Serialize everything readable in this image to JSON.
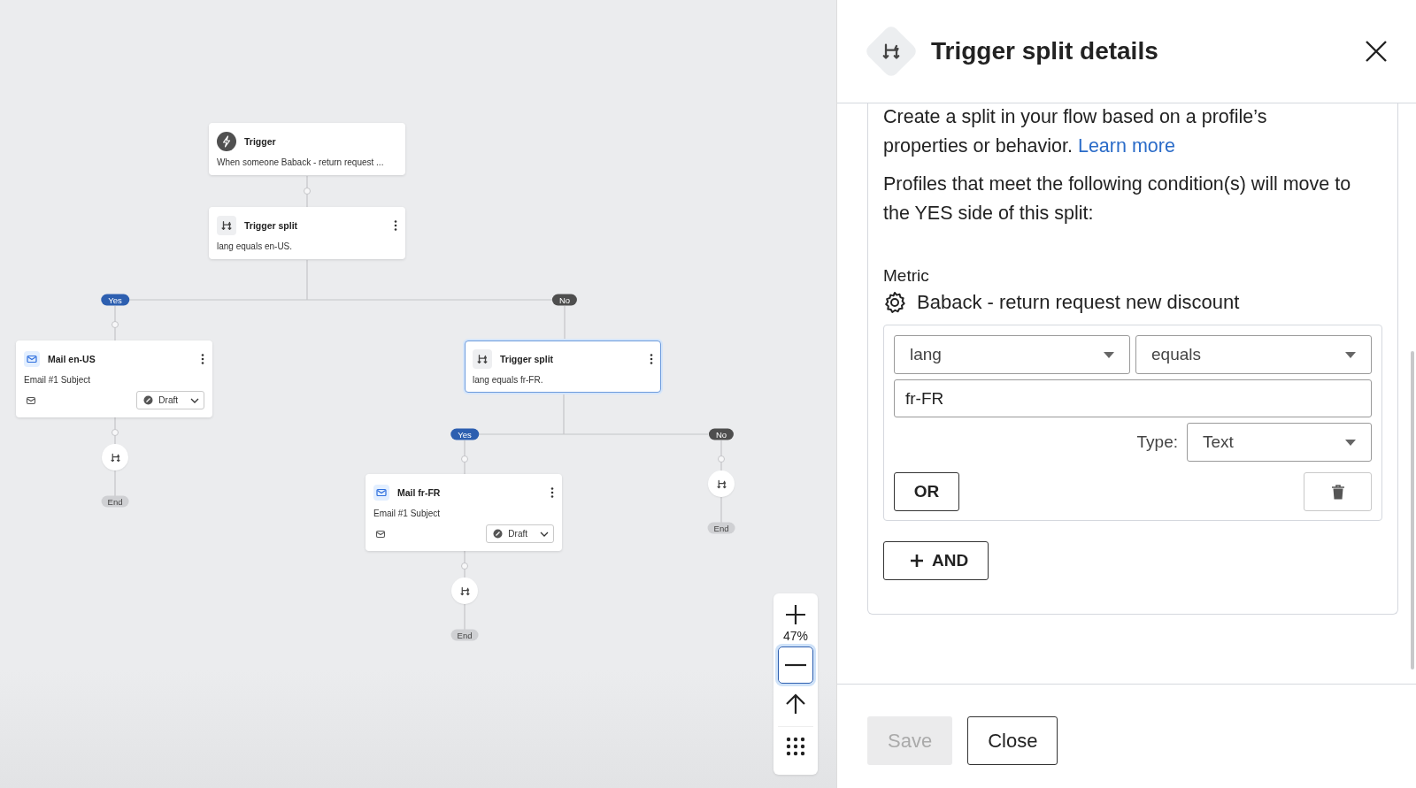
{
  "canvas": {
    "nodes": [
      {
        "kind": "trigger",
        "title": "Trigger",
        "description": "When someone Baback - return request ...",
        "selected": false
      },
      {
        "kind": "split",
        "title": "Trigger split",
        "description": "lang equals en-US.",
        "selected": false
      },
      {
        "kind": "email",
        "title": "Mail en-US",
        "description": "Email #1 Subject",
        "status": "Draft",
        "selected": false
      },
      {
        "kind": "split",
        "title": "Trigger split",
        "description": "lang equals fr-FR.",
        "selected": true
      },
      {
        "kind": "email",
        "title": "Mail fr-FR",
        "description": "Email #1 Subject",
        "status": "Draft",
        "selected": false
      }
    ],
    "branch_labels": [
      {
        "kind": "yes",
        "text": "Yes"
      },
      {
        "kind": "no",
        "text": "No"
      },
      {
        "kind": "yes",
        "text": "Yes"
      },
      {
        "kind": "no",
        "text": "No"
      }
    ],
    "end_labels": [
      "End",
      "End",
      "End"
    ],
    "zoom": {
      "level_text": "47%"
    }
  },
  "panel": {
    "title": "Trigger split details",
    "description": "Create a split in your flow based on a profile’s properties or behavior.",
    "link": "Learn more",
    "intro": "Profiles that meet the following condition(s) will move to the YES side of this split:",
    "metric_label": "Metric",
    "metric_name": "Baback - return request new discount",
    "condition": {
      "property": "lang",
      "operator": "equals",
      "value": "fr-FR",
      "type_label": "Type:",
      "type": "Text",
      "or_button": "OR"
    },
    "and_button": "AND",
    "buttons": [
      {
        "kind": "save",
        "label": "Save",
        "disabled": true
      },
      {
        "kind": "close",
        "label": "Close",
        "disabled": false
      }
    ]
  }
}
